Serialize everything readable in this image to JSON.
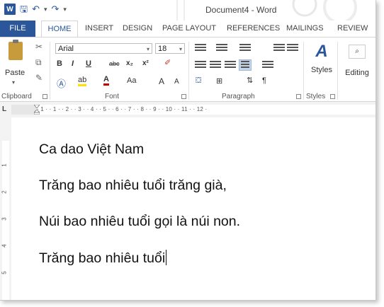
{
  "window": {
    "title": "Document4 - Word"
  },
  "qat": {
    "save": "🖫",
    "undo": "↶",
    "redo": "↷",
    "customize": "▾"
  },
  "tabs": [
    "FILE",
    "HOME",
    "INSERT",
    "DESIGN",
    "PAGE LAYOUT",
    "REFERENCES",
    "MAILINGS",
    "REVIEW"
  ],
  "ribbon": {
    "clipboard": {
      "paste_label": "Paste",
      "group_label": "Clipboard"
    },
    "font": {
      "font_name": "Arial",
      "font_size": "18",
      "group_label": "Font",
      "bold": "B",
      "italic": "I",
      "underline": "U",
      "strike": "abc",
      "subscript": "x₂",
      "superscript": "x²",
      "change_case": "Aa",
      "grow": "A",
      "shrink": "A"
    },
    "paragraph": {
      "group_label": "Paragraph",
      "show_marks": "¶"
    },
    "styles": {
      "label": "Styles",
      "group_label": "Styles"
    },
    "editing": {
      "label": "Editing"
    }
  },
  "ruler": {
    "corner": "L",
    "ticks": "· 1 · · 1 · · 2 · · 3 · · 4 · · 5 · · 6 · · 7 · · 8 · · 9 · · 10 · · 11 · · 12 ·",
    "vertical": [
      "1",
      "2",
      "3",
      "4",
      "5"
    ]
  },
  "document": {
    "lines": [
      "Ca dao Việt Nam",
      "Trăng bao nhiêu tuổi trăng già,",
      "Núi bao nhiêu tuổi gọi là núi non.",
      "Trăng bao nhiêu tuổi"
    ]
  },
  "colors": {
    "accent": "#2b579a"
  }
}
